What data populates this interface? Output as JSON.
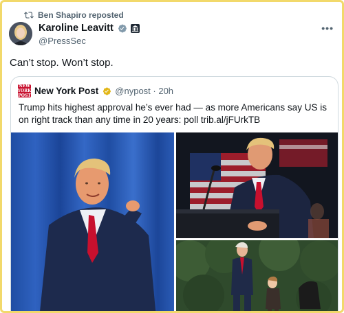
{
  "repost": {
    "icon": "repost-icon",
    "label": "Ben Shapiro reposted"
  },
  "author": {
    "name": "Karoline Leavitt",
    "handle": "@PressSec",
    "badges": [
      "verified-gray-icon",
      "government-building-icon"
    ]
  },
  "tweet": {
    "text": "Can’t stop. Won’t stop."
  },
  "more_label": "•••",
  "quote": {
    "source_name": "New York Post",
    "logo_text": [
      "NEW",
      "YORK",
      "POST"
    ],
    "handle": "@nypost",
    "time": "20h",
    "handle_time": "@nypost · 20h",
    "text": "Trump hits highest approval he’s ever had — as more Americans say US is on right track than any time in 20 years: poll trib.al/jFUrkTB"
  },
  "colors": {
    "frame": "#f2d96b",
    "verified_gold": "#e2b719",
    "verified_gray": "#829aab",
    "nypost_red": "#c8102e",
    "secondary_text": "#536471"
  }
}
